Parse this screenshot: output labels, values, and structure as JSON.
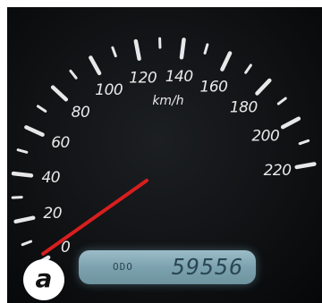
{
  "gauge": {
    "unit_label": "km/h",
    "scale_labels": [
      "0",
      "20",
      "40",
      "60",
      "80",
      "100",
      "120",
      "140",
      "160",
      "180",
      "200",
      "220"
    ],
    "needle_value_kmh": 0,
    "needle_color": "#d81e1e",
    "tick_color": "#e8e8e8",
    "face_color": "#101214"
  },
  "odometer": {
    "label": "ODO",
    "value": "59556",
    "display_color": "#8db0bc"
  },
  "panel_badge": {
    "label": "a"
  }
}
